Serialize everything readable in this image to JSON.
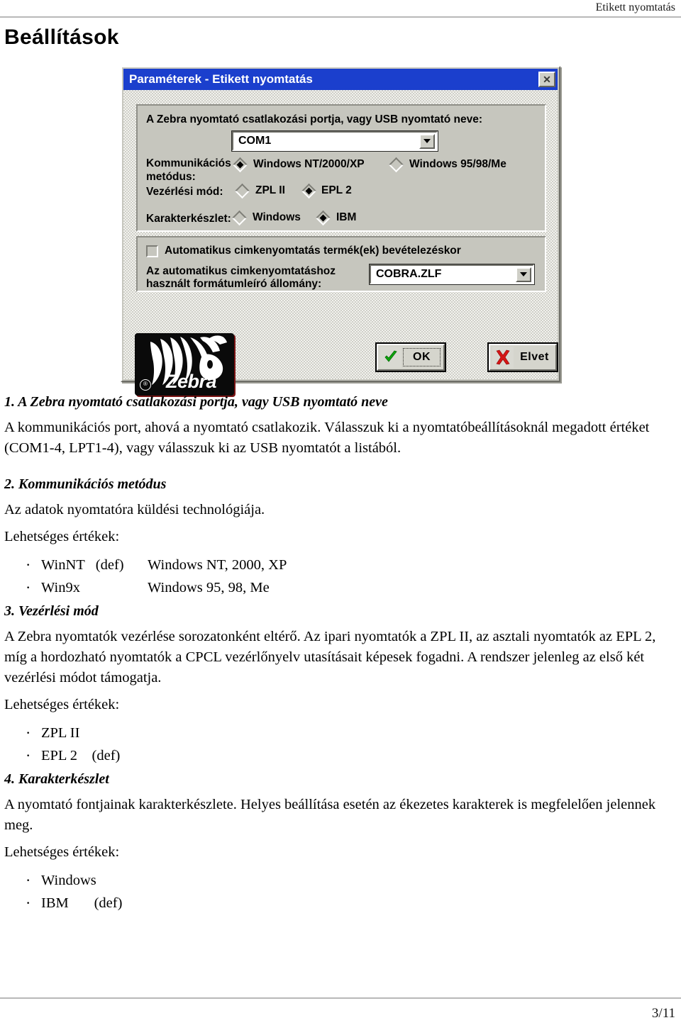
{
  "page": {
    "header_text": "Etikett nyomtatás",
    "title": "Beállítások",
    "page_number": "3/11"
  },
  "dialog": {
    "titlebar": "Paraméterek - Etikett nyomtatás",
    "close_label": "✕",
    "port_label": "A Zebra nyomtató csatlakozási portja, vagy USB nyomtató neve:",
    "port_value": "COM1",
    "comm_label_line1": "Kommunikációs",
    "comm_label_line2": "metódus:",
    "comm_option_1": "Windows NT/2000/XP",
    "comm_option_2": "Windows 95/98/Me",
    "control_label": "Vezérlési mód:",
    "control_option_1": "ZPL II",
    "control_option_2": "EPL 2",
    "charset_label": "Karakterkészlet:",
    "charset_option_1": "Windows",
    "charset_option_2": "IBM",
    "auto_print_label": "Automatikus cimkenyomtatás termék(ek) bevételezéskor",
    "format_file_label_line1": "Az automatikus cimkenyomtatáshoz",
    "format_file_label_line2": "használt formátumleíró állomány:",
    "format_file_value": "COBRA.ZLF",
    "logo_text": "Zebra",
    "logo_reg": "®",
    "ok_button": "OK",
    "cancel_button": "Elvet",
    "accent_titlebar": "#1b3fcd",
    "face_color": "#c6c6be",
    "ok_icon": "green-check-icon",
    "cancel_icon": "red-x-icon"
  },
  "sections": [
    {
      "heading": "1. A Zebra nyomtató csatlakozási portja, vagy USB nyomtató neve",
      "body": "A kommunikációs port, ahová a nyomtató csatlakozik. Válasszuk ki a nyomtatóbeállításoknál megadott értéket (COM1-4, LPT1-4), vagy válasszuk ki az USB nyomtatót a listából."
    },
    {
      "heading": "2. Kommunikációs metódus",
      "body": "Az adatok nyomtatóra küldési technológiája.",
      "values_label": "Lehetséges értékek:",
      "values": [
        {
          "term": "WinNT   (def)",
          "def": "Windows NT, 2000, XP"
        },
        {
          "term": "Win9x",
          "def": "Windows 95, 98, Me"
        }
      ]
    },
    {
      "heading": "3. Vezérlési mód",
      "body": "A Zebra nyomtatók vezérlése sorozatonként eltérő. Az ipari nyomtatók a ZPL II, az asztali nyomtatók az EPL 2, míg a hordozható nyomtatók a CPCL vezérlőnyelv utasításait képesek fogadni. A rendszer jelenleg az első két vezérlési módot támogatja.",
      "values_label": "Lehetséges értékek:",
      "values": [
        {
          "term": "ZPL II",
          "def": ""
        },
        {
          "term": "EPL 2    (def)",
          "def": ""
        }
      ]
    },
    {
      "heading": "4. Karakterkészlet",
      "body": "A nyomtató fontjainak karakterkészlete. Helyes beállítása esetén az ékezetes karakterek is megfelelően jelennek meg.",
      "values_label": "Lehetséges értékek:",
      "values": [
        {
          "term": "Windows",
          "def": ""
        },
        {
          "term": "IBM       (def)",
          "def": ""
        }
      ]
    }
  ]
}
